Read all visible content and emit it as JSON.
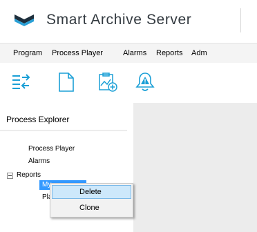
{
  "app": {
    "title": "Smart Archive Server",
    "logo_icon": "sas-logo-icon",
    "logo_color": "#1e2f3c",
    "logo_accent": "#2aa0d6"
  },
  "menubar": {
    "items": [
      {
        "label": "Program"
      },
      {
        "label": "Process Player"
      },
      {
        "label": "Alarms"
      },
      {
        "label": "Reports"
      },
      {
        "label": "Adm"
      }
    ]
  },
  "toolbar": {
    "buttons": [
      {
        "icon": "import-icon"
      },
      {
        "icon": "new-document-icon"
      },
      {
        "icon": "add-report-icon"
      },
      {
        "icon": "alarm-warning-icon"
      }
    ],
    "icon_color": "#1a9fd6"
  },
  "explorer": {
    "title": "Process Explorer",
    "items": [
      {
        "label": "Process Player"
      },
      {
        "label": "Alarms"
      },
      {
        "label": "Reports"
      },
      {
        "label": "My"
      },
      {
        "label": "Pla"
      }
    ]
  },
  "context_menu": {
    "items": [
      {
        "label": "Delete"
      },
      {
        "label": "Clone"
      }
    ],
    "highlight_color": "#cde8fb"
  },
  "colors": {
    "selection": "#3399ff",
    "content_bg": "#ececec"
  }
}
